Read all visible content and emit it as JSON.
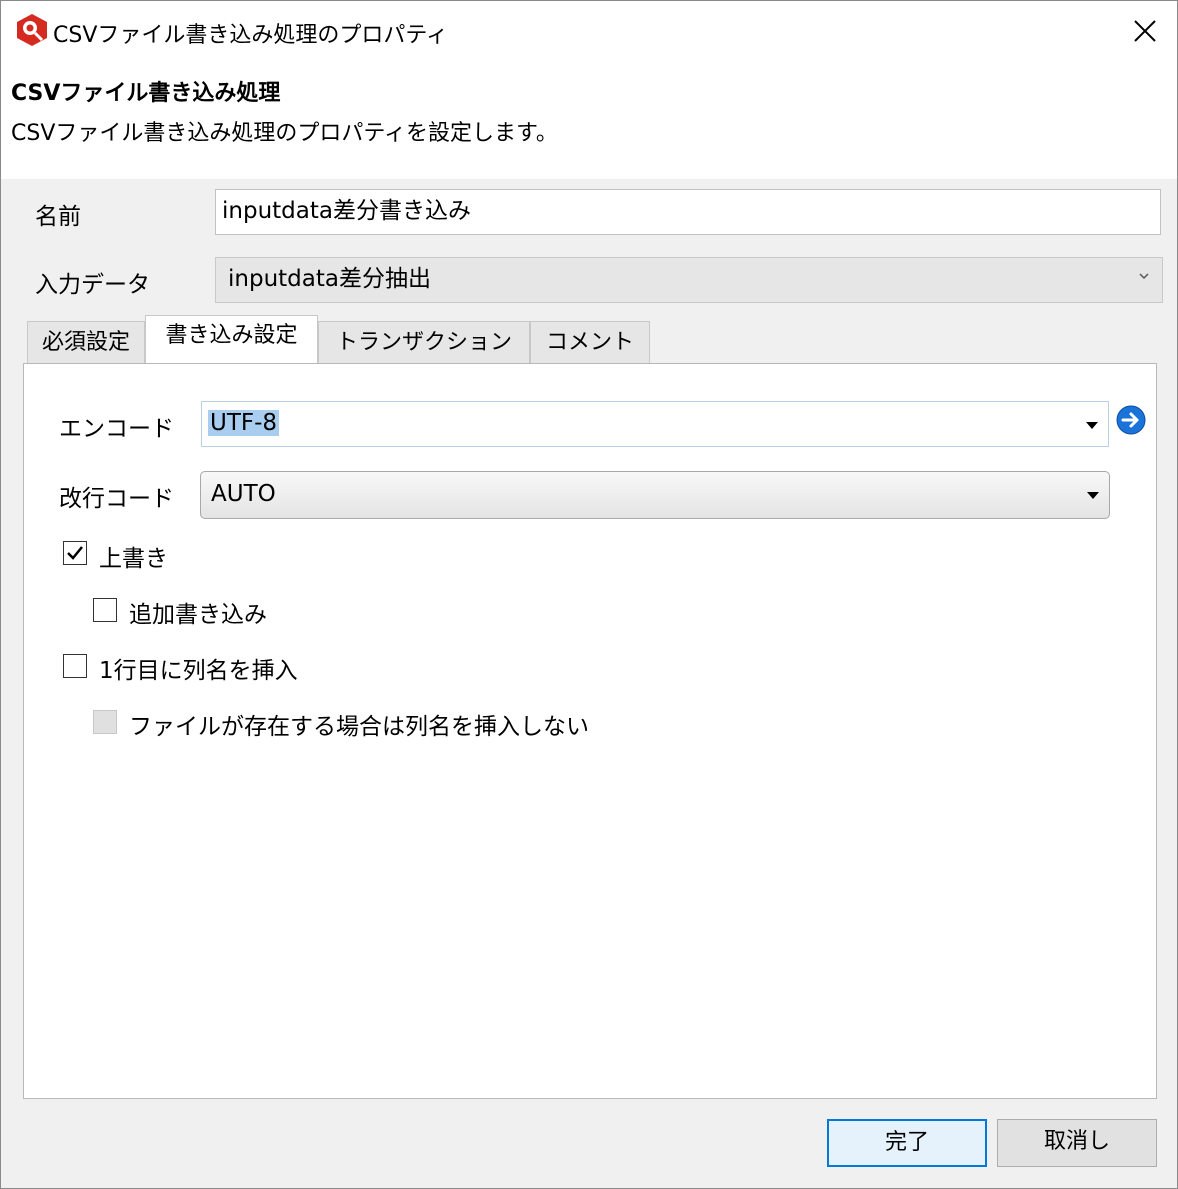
{
  "window": {
    "title": "CSVファイル書き込み処理のプロパティ",
    "icon": "app-logo-icon",
    "close_icon": "close-icon"
  },
  "header": {
    "title": "CSVファイル書き込み処理",
    "description": "CSVファイル書き込み処理のプロパティを設定します。"
  },
  "form": {
    "name_label": "名前",
    "name_value": "inputdata差分書き込み",
    "input_label": "入力データ",
    "input_value": "inputdata差分抽出"
  },
  "tabs": [
    {
      "label": "必須設定",
      "active": false
    },
    {
      "label": "書き込み設定",
      "active": true
    },
    {
      "label": "トランザクション",
      "active": false
    },
    {
      "label": "コメント",
      "active": false
    }
  ],
  "write_settings": {
    "encode_label": "エンコード",
    "encode_value": "UTF-8",
    "newline_label": "改行コード",
    "newline_value": "AUTO",
    "overwrite": {
      "label": "上書き",
      "checked": true
    },
    "append": {
      "label": "追加書き込み",
      "checked": false
    },
    "insert_header": {
      "label": "1行目に列名を挿入",
      "checked": false
    },
    "skip_header_if_exists": {
      "label": "ファイルが存在する場合は列名を挿入しない",
      "checked": false,
      "disabled": true
    }
  },
  "buttons": {
    "ok": "完了",
    "cancel": "取消し"
  },
  "colors": {
    "accent": "#0078d7",
    "selection": "#a8cdee",
    "go_icon": "#1a73d9",
    "app_icon": "#d42a1f"
  }
}
